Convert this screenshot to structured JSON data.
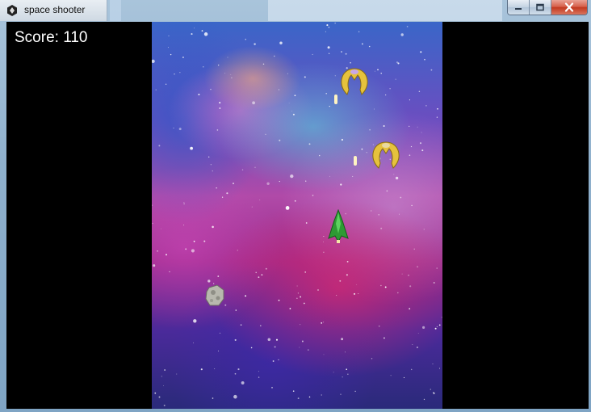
{
  "window": {
    "title": "space shooter",
    "app_icon": "unity-logo-icon",
    "controls": [
      "minimize-icon",
      "maximize-icon",
      "close-icon"
    ]
  },
  "hud": {
    "score_text": "Score: 110"
  },
  "game": {
    "background": "space-nebula",
    "entities": {
      "player": "player-ship (green)",
      "enemies": [
        "enemy-ship (yellow)",
        "enemy-ship (yellow)"
      ],
      "asteroids": [
        "asteroid (grey)"
      ],
      "projectiles": [
        "enemy-bolt",
        "enemy-bolt",
        "player-bolt"
      ]
    },
    "colors": {
      "player": "#2e9a34",
      "enemy": "#e9c63a",
      "asteroid": "#b8b8ae",
      "bolt": "#fff7d0"
    }
  }
}
